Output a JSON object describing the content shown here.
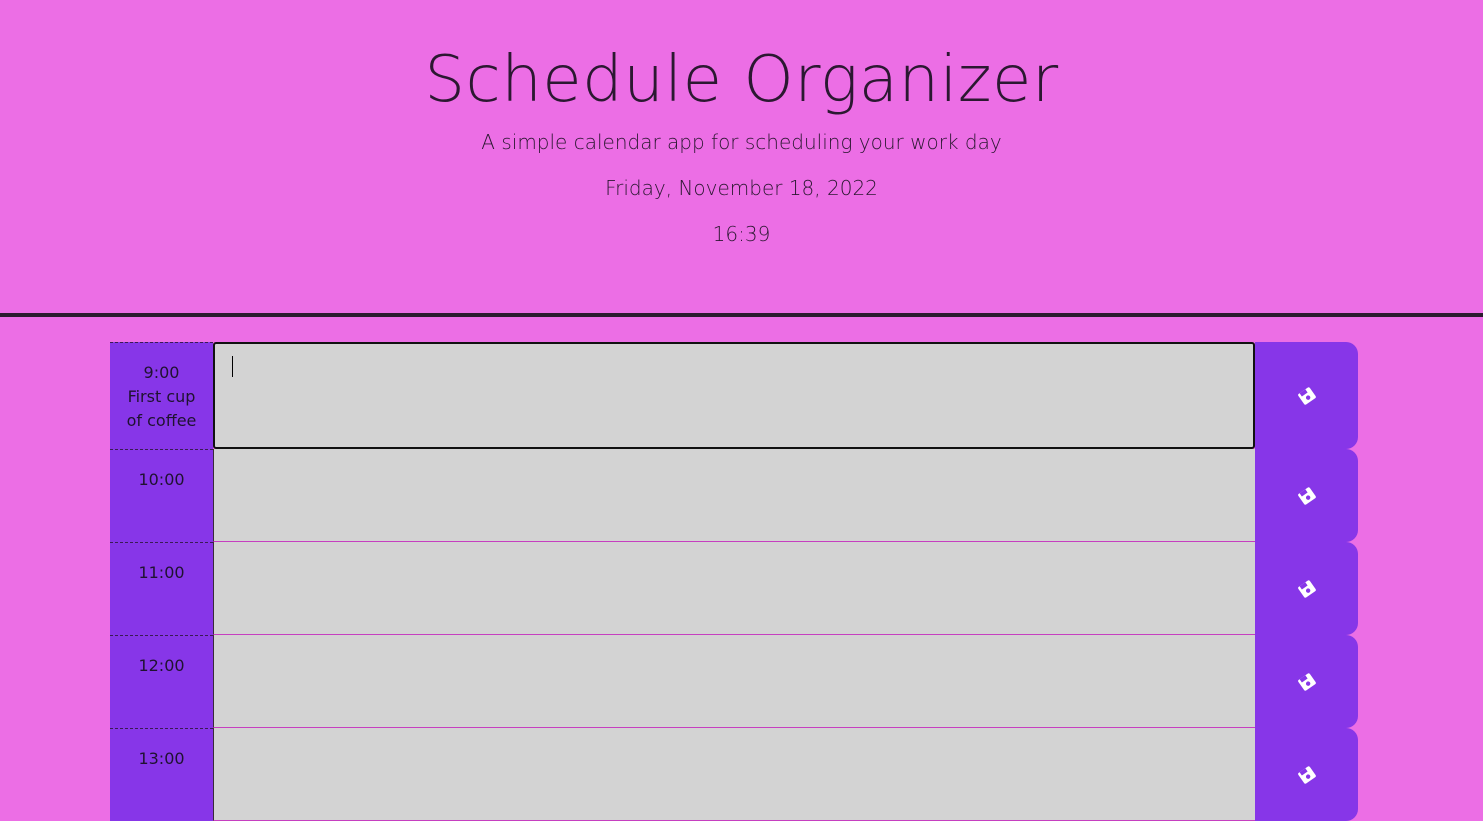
{
  "header": {
    "title": "Schedule Organizer",
    "subtitle": "A simple calendar app for scheduling your work day",
    "date": "Friday, November 18, 2022",
    "time": "16:39"
  },
  "schedule": {
    "rows": [
      {
        "hour": "9:00",
        "hour_note": "First cup of coffee",
        "task_value": ""
      },
      {
        "hour": "10:00",
        "hour_note": "",
        "task_value": ""
      },
      {
        "hour": "11:00",
        "hour_note": "",
        "task_value": ""
      },
      {
        "hour": "12:00",
        "hour_note": "",
        "task_value": ""
      },
      {
        "hour": "13:00",
        "hour_note": "",
        "task_value": ""
      }
    ],
    "save_icon": "save-icon"
  },
  "colors": {
    "background": "#ec6ee5",
    "hour_block": "#8736e8",
    "textarea": "#d3d3d3",
    "divider": "#2b1a2e"
  }
}
